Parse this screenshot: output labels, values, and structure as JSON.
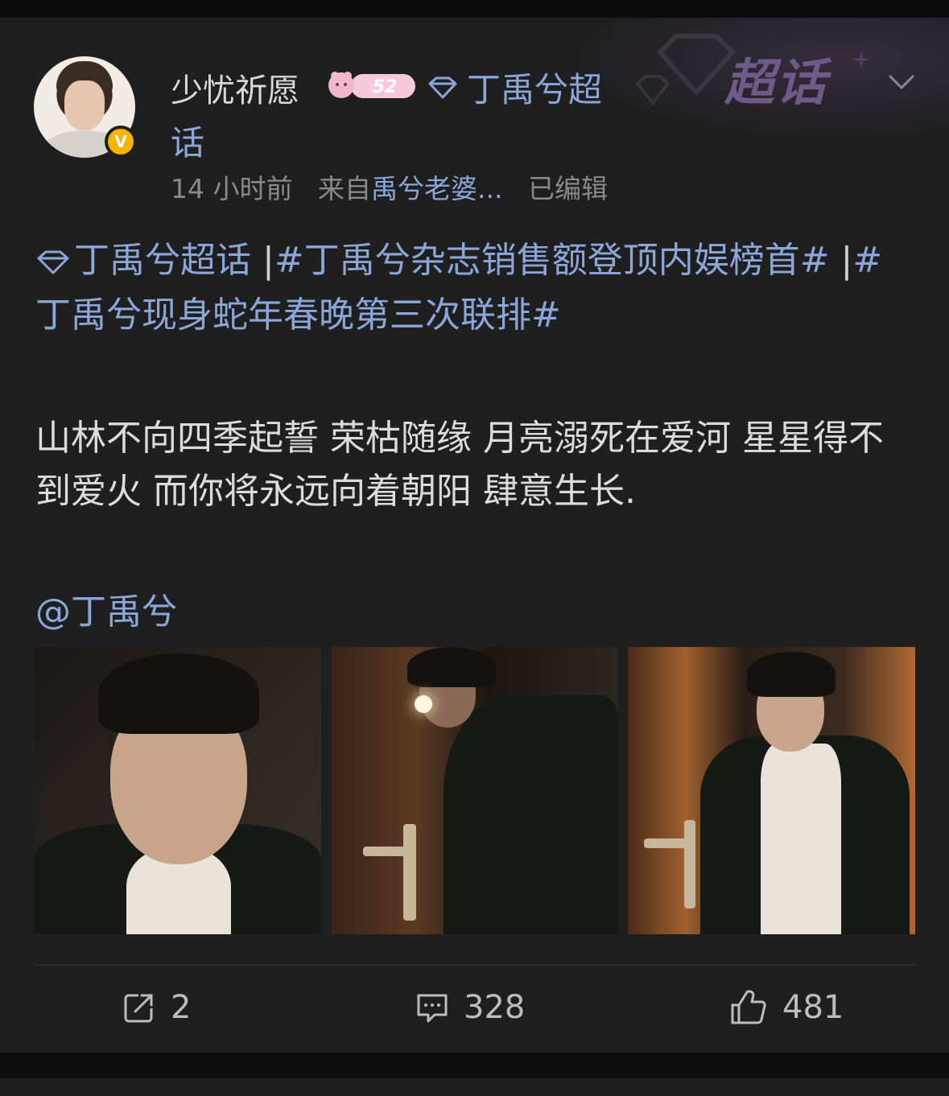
{
  "post": {
    "username": "少忧祈愿",
    "level_badge": "52",
    "topic_line1": "丁禹兮超",
    "topic_line2": "话",
    "time": "14 小时前",
    "source_prefix": "来自",
    "source": "禹兮老婆...",
    "edited": "已编辑",
    "header_deco_text": "超话",
    "tags": {
      "supertopic": "丁禹兮超话",
      "sep1": "  |",
      "tag1": "#丁禹兮杂志销售额登顶内娱榜首#",
      "sep2": " |",
      "tag2": "#丁禹兮现身蛇年春晚第三次联排#"
    },
    "body": "山林不向四季起誓 荣枯随缘 月亮溺死在爱河 星星得不到爱火 而你将永远向着朝阳 肆意生长.",
    "mention": "@丁禹兮",
    "verified_badge": "V"
  },
  "actions": {
    "share_count": "2",
    "comment_count": "328",
    "like_count": "481"
  },
  "colors": {
    "link": "#8ba6d8",
    "text": "#dcdcdc",
    "meta": "#8a8a8a",
    "card_bg": "#1f1f1f",
    "verified": "#f5b400"
  },
  "icons": [
    "chevron-down-icon",
    "diamond-icon",
    "share-icon",
    "comment-icon",
    "like-icon"
  ]
}
